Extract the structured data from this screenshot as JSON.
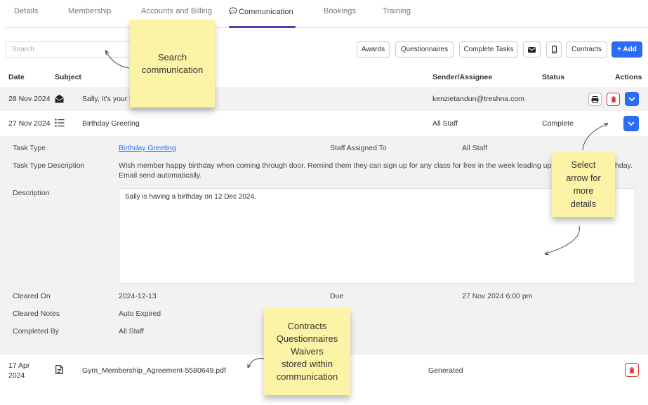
{
  "tabs": [
    {
      "label": "Details"
    },
    {
      "label": "Membership"
    },
    {
      "label": "Accounts and Billing"
    },
    {
      "label": "Communication"
    },
    {
      "label": "Bookings"
    },
    {
      "label": "Training"
    }
  ],
  "search": {
    "placeholder": "Search"
  },
  "toolbar": {
    "awards": "Awards",
    "questionnaires": "Questionnaires",
    "complete_tasks": "Complete Tasks",
    "contracts": "Contracts",
    "add": "+ Add"
  },
  "table": {
    "headers": {
      "date": "Date",
      "subject": "Subject",
      "sender": "Sender/Assignee",
      "status": "Status",
      "actions": "Actions"
    },
    "rows": [
      {
        "date": "28 Nov 2024",
        "subject": "Sally, It's your b",
        "sender": "kenzietandun@treshna.com",
        "status": "",
        "icon": "envelope-open-icon"
      },
      {
        "date": "27 Nov 2024",
        "subject": "Birthday Greeting",
        "sender": "All Staff",
        "status": "Complete",
        "icon": "task-list-icon"
      },
      {
        "date_line1": "17 Apr",
        "date_line2": "2024",
        "subject": "Gym_Membership_Agreement-5580649.pdf",
        "sender": "",
        "status": "Generated",
        "icon": "document-icon"
      }
    ]
  },
  "detail": {
    "task_type_label": "Task Type",
    "task_type_value": "Birthday Greeting",
    "staff_assigned_label": "Staff Assigned To",
    "staff_assigned_value": "All Staff",
    "task_desc_label": "Task Type Description",
    "task_desc_line1": "Wish member happy birthday when coming through door. Remind them they can sign up for any class for free in the week leading up to and",
    "task_desc_tail": "hday.",
    "task_desc_line2": "Email send automatically.",
    "description_label": "Description",
    "description_value": "Sally is having a birthday on 12 Dec 2024.",
    "cleared_on_label": "Cleared On",
    "cleared_on_value": "2024-12-13",
    "due_label": "Due",
    "due_value": "27 Nov 2024 6:00 pm",
    "cleared_notes_label": "Cleared Notes",
    "cleared_notes_value": "Auto Expired",
    "completed_by_label": "Completed By",
    "completed_by_value": "All Staff"
  },
  "notes": {
    "search": [
      "Search",
      "communication"
    ],
    "arrow": [
      "Select",
      "arrow for",
      "more",
      "details"
    ],
    "contracts": [
      "Contracts",
      "Questionnaires",
      "Waivers",
      "stored within",
      "communication"
    ]
  },
  "colors": {
    "accent": "#2a6df4",
    "tab_underline": "#4b3fb8",
    "note": "#fbf3a5",
    "delete": "#dd3333"
  }
}
